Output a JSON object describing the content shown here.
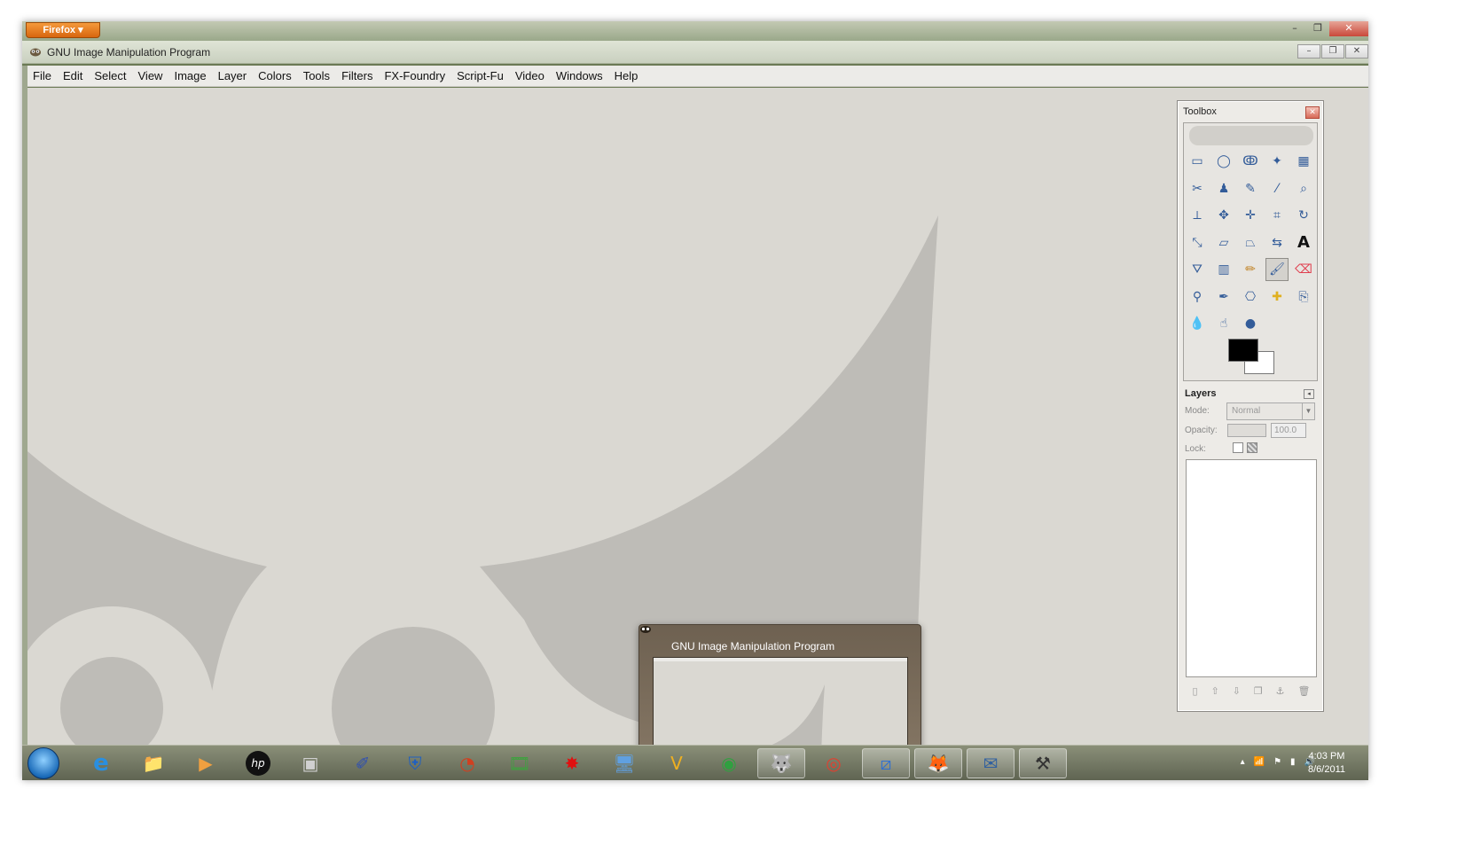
{
  "firefox": {
    "button_label": "Firefox ▾"
  },
  "window_controls": {
    "minimize": "–",
    "restore": "❐",
    "close": "✕"
  },
  "gimp": {
    "title": "GNU Image Manipulation Program",
    "menu": [
      "File",
      "Edit",
      "Select",
      "View",
      "Image",
      "Layer",
      "Colors",
      "Tools",
      "Filters",
      "FX-Foundry",
      "Script-Fu",
      "Video",
      "Windows",
      "Help"
    ]
  },
  "toolbox": {
    "title": "Toolbox",
    "close_icon": "✕",
    "tools": [
      {
        "name": "rect-select-icon",
        "glyph": "▭"
      },
      {
        "name": "ellipse-select-icon",
        "glyph": "◯"
      },
      {
        "name": "free-select-icon",
        "glyph": "ↂ"
      },
      {
        "name": "fuzzy-select-icon",
        "glyph": "✦"
      },
      {
        "name": "select-by-color-icon",
        "glyph": "▦"
      },
      {
        "name": "scissors-select-icon",
        "glyph": "✂"
      },
      {
        "name": "foreground-select-icon",
        "glyph": "♟"
      },
      {
        "name": "paths-icon",
        "glyph": "✎"
      },
      {
        "name": "color-picker-icon",
        "glyph": "⁄"
      },
      {
        "name": "zoom-icon",
        "glyph": "⌕"
      },
      {
        "name": "measure-icon",
        "glyph": "⟂"
      },
      {
        "name": "move-icon",
        "glyph": "✥"
      },
      {
        "name": "align-icon",
        "glyph": "✛"
      },
      {
        "name": "crop-icon",
        "glyph": "⌗"
      },
      {
        "name": "rotate-icon",
        "glyph": "↻"
      },
      {
        "name": "scale-icon",
        "glyph": "⤡"
      },
      {
        "name": "shear-icon",
        "glyph": "▱"
      },
      {
        "name": "perspective-icon",
        "glyph": "⏢"
      },
      {
        "name": "flip-icon",
        "glyph": "⇆"
      },
      {
        "name": "text-icon",
        "glyph": "A"
      },
      {
        "name": "bucket-fill-icon",
        "glyph": "⛛"
      },
      {
        "name": "blend-icon",
        "glyph": "▥"
      },
      {
        "name": "pencil-icon",
        "glyph": "✏"
      },
      {
        "name": "paintbrush-icon",
        "glyph": "🖌"
      },
      {
        "name": "eraser-icon",
        "glyph": "⌫"
      },
      {
        "name": "airbrush-icon",
        "glyph": "⚲"
      },
      {
        "name": "ink-icon",
        "glyph": "✒"
      },
      {
        "name": "clone-icon",
        "glyph": "⎔"
      },
      {
        "name": "heal-icon",
        "glyph": "✚"
      },
      {
        "name": "perspective-clone-icon",
        "glyph": "⎘"
      },
      {
        "name": "blur-sharpen-icon",
        "glyph": "💧"
      },
      {
        "name": "smudge-icon",
        "glyph": "☝"
      },
      {
        "name": "dodge-burn-icon",
        "glyph": "●"
      }
    ],
    "selected_tool_index": 23,
    "colors": {
      "foreground": "#000000",
      "background": "#ffffff"
    }
  },
  "layers": {
    "title": "Layers",
    "mode_label": "Mode:",
    "mode_value": "Normal",
    "opacity_label": "Opacity:",
    "opacity_value": "100.0",
    "lock_label": "Lock:",
    "buttons": [
      {
        "name": "new-layer-icon",
        "glyph": "▯"
      },
      {
        "name": "raise-layer-icon",
        "glyph": "⇧"
      },
      {
        "name": "lower-layer-icon",
        "glyph": "⇩"
      },
      {
        "name": "duplicate-layer-icon",
        "glyph": "❐"
      },
      {
        "name": "anchor-layer-icon",
        "glyph": "⚓"
      },
      {
        "name": "delete-layer-icon",
        "glyph": "🗑"
      }
    ]
  },
  "preview": {
    "title": "GNU Image Manipulation Program"
  },
  "taskbar": {
    "items": [
      {
        "name": "internet-explorer-icon",
        "glyph": "e",
        "color": "#2a8fe0",
        "active": false
      },
      {
        "name": "file-explorer-icon",
        "glyph": "📁",
        "color": "#e8c25a",
        "active": false
      },
      {
        "name": "media-player-icon",
        "glyph": "▶",
        "color": "#f0a040",
        "active": false
      },
      {
        "name": "hp-icon",
        "glyph": "hp",
        "color": "#111111",
        "active": false
      },
      {
        "name": "virtual-pc-icon",
        "glyph": "▣",
        "color": "#d0d0d0",
        "active": false
      },
      {
        "name": "ink-editor-icon",
        "glyph": "✐",
        "color": "#3050b0",
        "active": false
      },
      {
        "name": "shield-app-icon",
        "glyph": "⛨",
        "color": "#2060c0",
        "active": false
      },
      {
        "name": "arc-app-icon",
        "glyph": "◔",
        "color": "#d04020",
        "active": false
      },
      {
        "name": "video-pro-icon",
        "glyph": "🎞",
        "color": "#40a040",
        "active": false
      },
      {
        "name": "splat-app-icon",
        "glyph": "✸",
        "color": "#e01010",
        "active": false
      },
      {
        "name": "remote-desktop-icon",
        "glyph": "🖥",
        "color": "#60a0e0",
        "active": false
      },
      {
        "name": "v-app-icon",
        "glyph": "V",
        "color": "#f0b020",
        "active": false
      },
      {
        "name": "camera-app-icon",
        "glyph": "◉",
        "color": "#30a040",
        "active": false
      },
      {
        "name": "gimp-icon",
        "glyph": "🐺",
        "color": "#6b5a40",
        "active": true
      },
      {
        "name": "chrome-icon",
        "glyph": "◎",
        "color": "#e04030",
        "active": false
      },
      {
        "name": "app-stripe-icon",
        "glyph": "⧄",
        "color": "#3070d0",
        "active": true
      },
      {
        "name": "firefox-icon",
        "glyph": "🦊",
        "color": "#e06010",
        "active": true
      },
      {
        "name": "thunderbird-icon",
        "glyph": "✉",
        "color": "#3060a0",
        "active": true
      },
      {
        "name": "tools-app-icon",
        "glyph": "⚒",
        "color": "#333333",
        "active": true
      }
    ],
    "tray": [
      "▴",
      "📶",
      "⚑",
      "▮",
      "🔊"
    ],
    "clock_time": "4:03 PM",
    "clock_date": "8/6/2011"
  }
}
